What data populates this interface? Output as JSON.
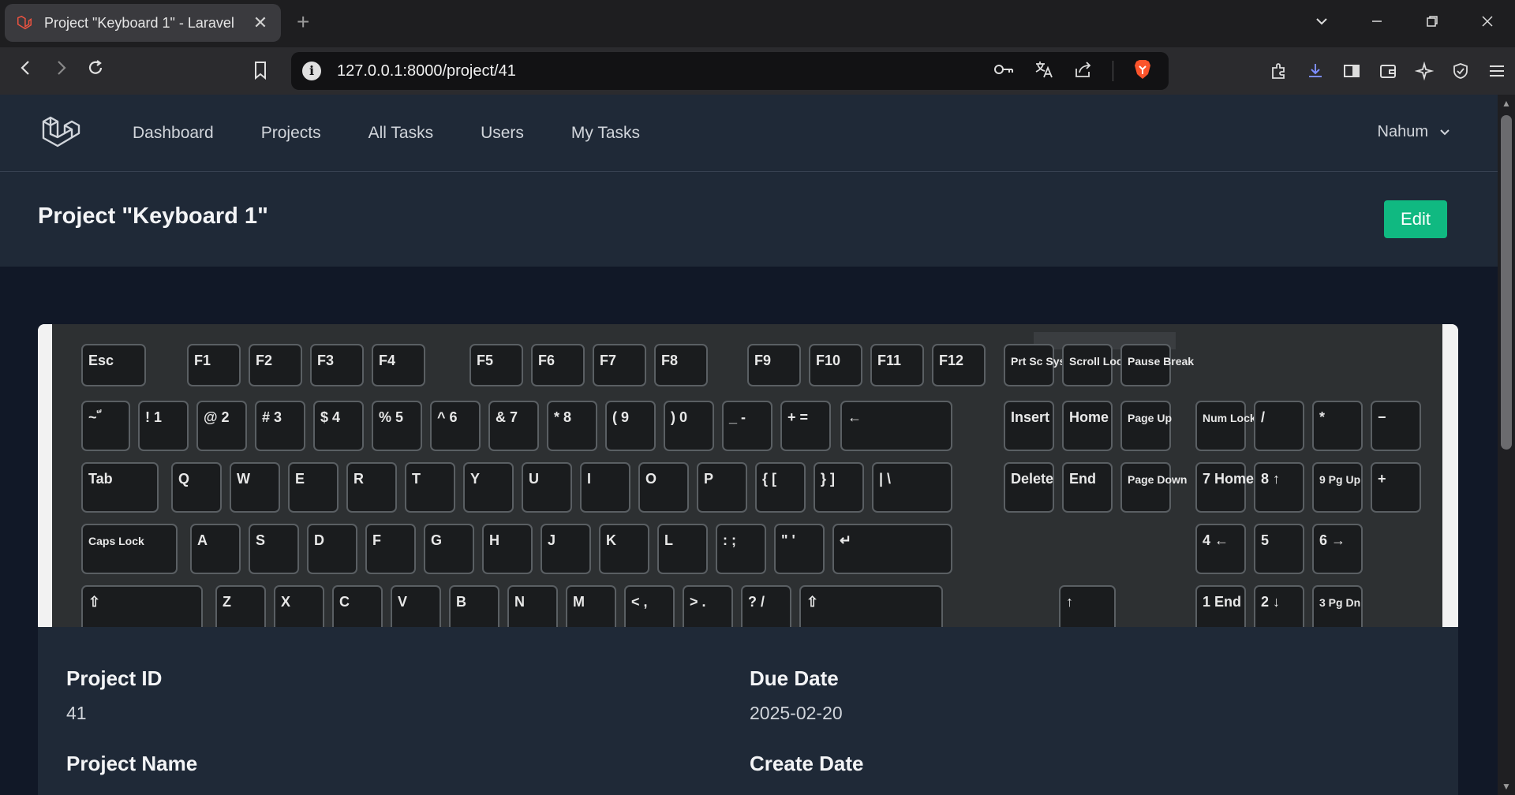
{
  "browser": {
    "tab_title": "Project \"Keyboard 1\" - Laravel",
    "url": "127.0.0.1:8000/project/41",
    "tab_close": "✕",
    "new_tab": "+"
  },
  "app": {
    "nav": [
      "Dashboard",
      "Projects",
      "All Tasks",
      "Users",
      "My Tasks"
    ],
    "user_name": "Nahum"
  },
  "page": {
    "title": "Project \"Keyboard 1\"",
    "edit_label": "Edit"
  },
  "details": {
    "project_id_label": "Project ID",
    "project_id_value": "41",
    "due_date_label": "Due Date",
    "due_date_value": "2025-02-20",
    "project_name_label": "Project Name",
    "create_date_label": "Create Date"
  },
  "keyboard": {
    "row0": [
      "Esc",
      "F1",
      "F2",
      "F3",
      "F4",
      "F5",
      "F6",
      "F7",
      "F8",
      "F9",
      "F10",
      "F11",
      "F12",
      "Prt Sc Sys Rq",
      "Scroll Lock",
      "Pause Break"
    ],
    "row1": [
      "~ ّ",
      "! 1",
      "@ 2",
      "# 3",
      "$ 4",
      "% 5",
      "^ 6",
      "& 7",
      "* 8",
      "( 9",
      ") 0",
      "_ -",
      "+ =",
      "←",
      "Insert",
      "Home",
      "Page Up",
      "Num Lock",
      "/",
      "*",
      "−"
    ],
    "row2": [
      "Tab",
      "Q",
      "W",
      "E",
      "R",
      "T",
      "Y",
      "U",
      "I",
      "O",
      "P",
      "{ [",
      "} ]",
      "| \\",
      "Delete",
      "End",
      "Page Down",
      "7 Home",
      "8 ↑",
      "9 Pg Up",
      "+"
    ],
    "row3": [
      "Caps Lock",
      "A",
      "S",
      "D",
      "F",
      "G",
      "H",
      "J",
      "K",
      "L",
      ": ;",
      "\" '",
      "↵",
      "4 ←",
      "5",
      "6 →"
    ],
    "row4": [
      "⇧",
      "Z",
      "X",
      "C",
      "V",
      "B",
      "N",
      "M",
      "< ,",
      "> .",
      "? /",
      "⇧",
      "↑",
      "1 End",
      "2 ↓",
      "3 Pg Dn"
    ]
  }
}
